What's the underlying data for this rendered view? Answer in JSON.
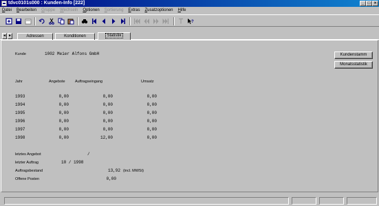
{
  "window": {
    "title": "tdvc0101s000 : Kunden-Info [222]",
    "buttons": [
      "_",
      "□",
      "×"
    ]
  },
  "menu": {
    "items": [
      {
        "label": "Datei",
        "enabled": true
      },
      {
        "label": "Bearbeiten",
        "enabled": true
      },
      {
        "label": "Gruppe",
        "enabled": false
      },
      {
        "label": "Wechseln",
        "enabled": false
      },
      {
        "label": "Optionen",
        "enabled": true
      },
      {
        "label": "Sortierung",
        "enabled": false
      },
      {
        "label": "Extras",
        "enabled": true
      },
      {
        "label": "Zusatzoptionen",
        "enabled": true
      },
      {
        "label": "Hilfe",
        "enabled": true
      }
    ]
  },
  "tabs": {
    "nav_prev": "◄",
    "nav_next": "►",
    "items": [
      "Adressen",
      "Konditionen",
      "Statistik"
    ],
    "active": "Statistik"
  },
  "content": {
    "kunde_label": "Kunde",
    "kunde_value": "1002 Meier Alfons GmbH",
    "buttons": {
      "kundenstamm": "Kundenstamm",
      "monatsstatistik": "Monatsstatistik"
    },
    "headers": {
      "jahr": "Jahr",
      "angebote": "Angebote",
      "auftragseingang": "Auftragseingang",
      "umsatz": "Umsatz"
    },
    "rows": [
      {
        "jahr": "1993",
        "angebote": "0,00",
        "auftragseingang": "0,00",
        "umsatz": "0,00"
      },
      {
        "jahr": "1994",
        "angebote": "0,00",
        "auftragseingang": "0,00",
        "umsatz": "0,00"
      },
      {
        "jahr": "1995",
        "angebote": "0,00",
        "auftragseingang": "0,00",
        "umsatz": "0,00"
      },
      {
        "jahr": "1996",
        "angebote": "0,00",
        "auftragseingang": "0,00",
        "umsatz": "0,00"
      },
      {
        "jahr": "1997",
        "angebote": "0,00",
        "auftragseingang": "0,00",
        "umsatz": "0,00"
      },
      {
        "jahr": "1998",
        "angebote": "0,00",
        "auftragseingang": "12,00",
        "umsatz": "0,00"
      }
    ],
    "letztes_angebot_label": "letztes Angebot",
    "letztes_angebot_value": "/",
    "letzter_auftrag_label": "letzter Auftrag",
    "letzter_auftrag_value": "10 / 1998",
    "auftragsbestand_label": "Auftragsbestand",
    "auftragsbestand_value": "13,92",
    "auftragsbestand_note": "(incl. MWSt)",
    "offene_posten_label": "Offene Posten",
    "offene_posten_value": "0,00"
  },
  "toolbar_icons": [
    "new-record-icon",
    "save-icon",
    "delete-icon",
    "undo-icon",
    "cut-icon",
    "copy-icon",
    "paste-icon",
    "find-icon",
    "first-record-icon",
    "prev-record-icon",
    "next-record-icon",
    "last-record-icon",
    "first-set-icon",
    "prev-set-icon",
    "next-set-icon",
    "last-set-icon",
    "text-icon",
    "context-help-icon"
  ]
}
